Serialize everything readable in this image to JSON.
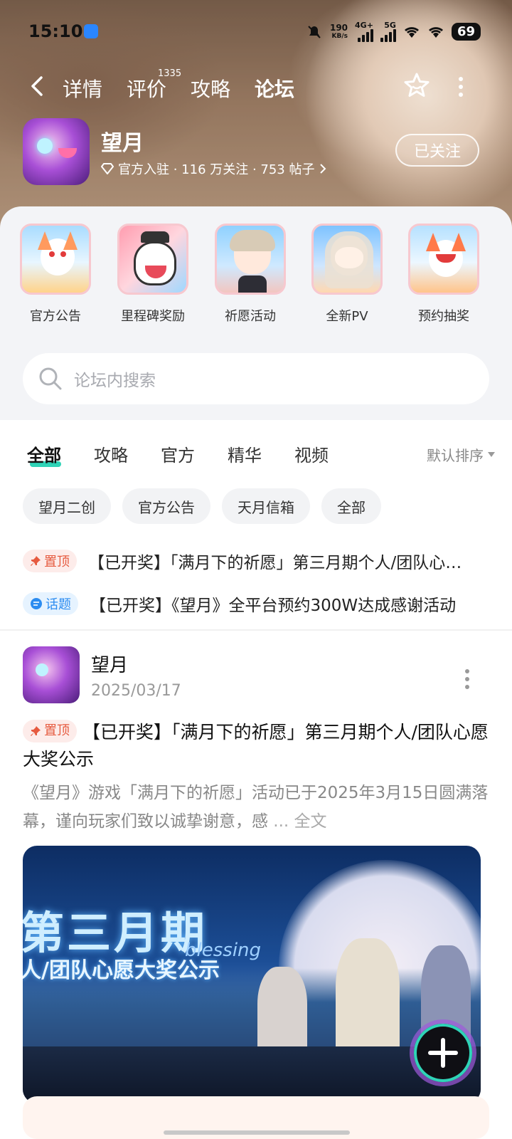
{
  "status_bar": {
    "time": "15:10",
    "net_speed_value": "190",
    "net_speed_unit": "KB/s",
    "network_1": "4G+",
    "network_2": "5G",
    "battery": "69"
  },
  "nav": {
    "tabs": [
      {
        "label": "详情"
      },
      {
        "label": "评价",
        "count": "1335"
      },
      {
        "label": "攻略"
      },
      {
        "label": "论坛"
      }
    ],
    "active_tab": "论坛"
  },
  "game": {
    "name": "望月",
    "meta": "官方入驻 · 116 万关注 · 753 帖子",
    "follow_label": "已关注"
  },
  "shortcuts": [
    {
      "label": "官方公告"
    },
    {
      "label": "里程碑奖励"
    },
    {
      "label": "祈愿活动"
    },
    {
      "label": "全新PV"
    },
    {
      "label": "预约抽奖"
    }
  ],
  "search": {
    "placeholder": "论坛内搜索"
  },
  "filter_tabs": [
    {
      "label": "全部"
    },
    {
      "label": "攻略"
    },
    {
      "label": "官方"
    },
    {
      "label": "精华"
    },
    {
      "label": "视频"
    }
  ],
  "sort_label": "默认排序",
  "chips": [
    {
      "label": "望月二创"
    },
    {
      "label": "官方公告"
    },
    {
      "label": "天月信箱"
    },
    {
      "label": "全部"
    }
  ],
  "pinned": [
    {
      "tag": "置顶",
      "text": "【已开奖】「满月下的祈愿」第三月期个人/团队心愿大奖公示"
    },
    {
      "tag": "话题",
      "text": "【已开奖】《望月》全平台预约300W达成感谢活动"
    }
  ],
  "post": {
    "author": "望月",
    "date": "2025/03/17",
    "tag": "置顶",
    "title": "【已开奖】「满月下的祈愿」第三月期个人/团队心愿大奖公示",
    "body": "《望月》游戏「满月下的祈愿」活动已于2025年3月15日圆满落幕，谨向玩家们致以诚挚谢意，感",
    "more": " ... 全文",
    "image_title": "第三月期",
    "image_subtitle": "人/团队心愿大奖公示",
    "image_script": "blessing"
  },
  "colors": {
    "accent": "#2fd3b7",
    "pin_tag": "#e65a3f",
    "topic_tag": "#2c8cf0"
  }
}
